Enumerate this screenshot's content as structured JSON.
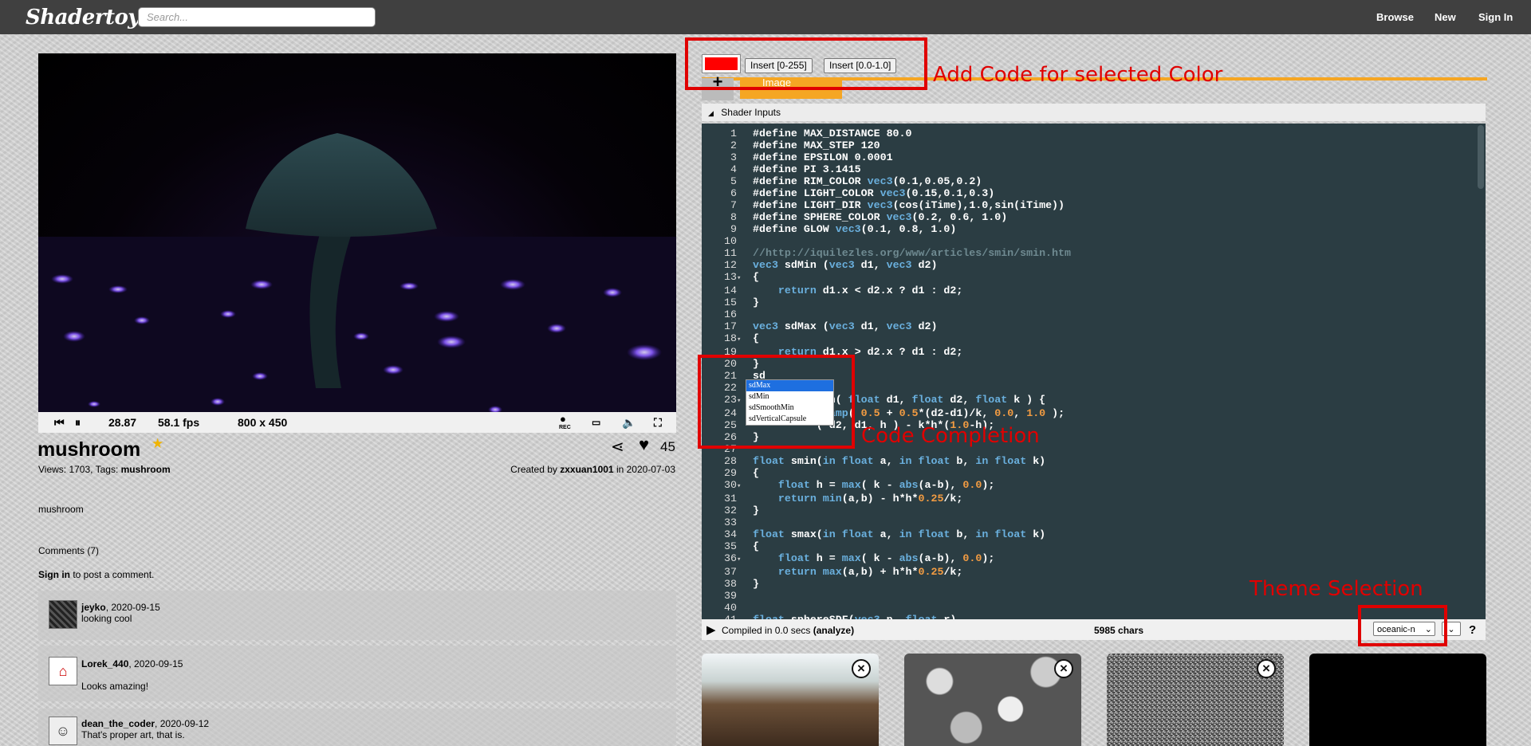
{
  "header": {
    "logo": "Shadertoy",
    "search_placeholder": "Search...",
    "nav": [
      "Browse",
      "New",
      "Sign In"
    ]
  },
  "player": {
    "time": "28.87",
    "fps": "58.1 fps",
    "resolution": "800 x 450",
    "rec_label": "REC"
  },
  "shader": {
    "name": "mushroom",
    "likes": "45",
    "views_label": "Views: 1703, Tags: ",
    "tag": "mushroom",
    "created_by_label": "Created by ",
    "author": "zxxuan1001",
    "date_label": " in 2020-07-03",
    "description": "mushroom"
  },
  "comments": {
    "header": "Comments (7)",
    "signin_label": "Sign in",
    "signin_suffix": " to post a comment.",
    "items": [
      {
        "user": "jeyko",
        "date": ", 2020-09-15",
        "text": "looking cool"
      },
      {
        "user": "Lorek_440",
        "date": ", 2020-09-15",
        "text": "Looks amazing!"
      },
      {
        "user": "dean_the_coder",
        "date": ", 2020-09-12",
        "text": "That's proper art, that is."
      }
    ]
  },
  "color_tool": {
    "insert_255": "Insert [0-255]",
    "insert_01": "Insert [0.0-1.0]",
    "color": "#ff0000"
  },
  "tabs": {
    "add": "+",
    "image": "Image"
  },
  "shader_inputs_label": "Shader Inputs",
  "code_lines": [
    "#define MAX_DISTANCE 80.0",
    "#define MAX_STEP 120",
    "#define EPSILON 0.0001",
    "#define PI 3.1415",
    "#define RIM_COLOR vec3(0.1,0.05,0.2)",
    "#define LIGHT_COLOR vec3(0.15,0.1,0.3)",
    "#define LIGHT_DIR vec3(cos(iTime),1.0,sin(iTime))",
    "#define SPHERE_COLOR vec3(0.2, 0.6, 1.0)",
    "#define GLOW vec3(0.1, 0.8, 1.0)",
    "",
    "//http://iquilezles.org/www/articles/smin/smin.htm",
    "vec3 sdMin (vec3 d1, vec3 d2)",
    "{",
    "    return d1.x < d2.x ? d1 : d2;",
    "}",
    "",
    "vec3 sdMax (vec3 d1, vec3 d2)",
    "{",
    "    return d1.x > d2.x ? d1 : d2;",
    "}",
    "sd",
    "",
    "          Min( float d1, float d2, float k ) {",
    "          clamp( 0.5 + 0.5*(d2-d1)/k, 0.0, 1.0 );",
    "          ( d2, d1, h ) - k*h*(1.0-h);",
    "}",
    "",
    "float smin(in float a, in float b, in float k)",
    "{",
    "    float h = max( k - abs(a-b), 0.0);",
    "    return min(a,b) - h*h*0.25/k;",
    "}",
    "",
    "float smax(in float a, in float b, in float k)",
    "{",
    "    float h = max( k - abs(a-b), 0.0);",
    "    return max(a,b) + h*h*0.25/k;",
    "}",
    "",
    "",
    "float sphereSDF(vec3 p, float r)"
  ],
  "fold_lines": [
    13,
    18,
    23,
    30,
    36
  ],
  "autocomplete": [
    "sdMax",
    "sdMin",
    "sdSmoothMin",
    "sdVerticalCapsule"
  ],
  "status": {
    "compiled_prefix": "Compiled in 0.0 secs ",
    "analyze": "(analyze)",
    "chars": "5985 chars",
    "theme": "oceanic-n",
    "help": "?"
  },
  "annotations": {
    "color": "Add Code for selected Color",
    "completion": "Code Completion",
    "theme": "Theme Selection"
  }
}
